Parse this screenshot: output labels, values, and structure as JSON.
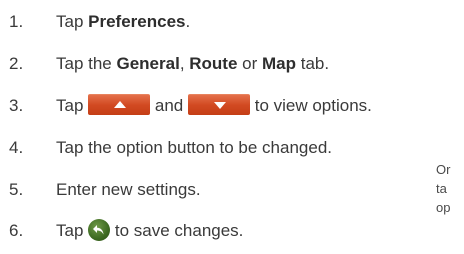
{
  "steps": [
    {
      "num": "1.",
      "pre": "Tap ",
      "bold": "Preferences",
      "post": "."
    },
    {
      "num": "2.",
      "pre": "Tap the ",
      "b1": "General",
      "sep1": ", ",
      "b2": "Route",
      "sep2": " or ",
      "b3": "Map",
      "post": " tab."
    },
    {
      "num": "3.",
      "pre": "Tap ",
      "mid": "and",
      "post": "to view options."
    },
    {
      "num": "4.",
      "text": "Tap the option button to be changed."
    },
    {
      "num": "5.",
      "text": "Enter new settings."
    },
    {
      "num": "6.",
      "pre": "Tap ",
      "post": "to save changes."
    }
  ],
  "side_note": {
    "line1": "Or",
    "line2": "ta",
    "line3": "op"
  },
  "icons": {
    "up": "up-arrow-button-icon",
    "down": "down-arrow-button-icon",
    "back": "back-arrow-icon"
  },
  "colors": {
    "text": "#3a3a3a",
    "arrow_button": "#d24a22",
    "back_button": "#3d6a22"
  }
}
